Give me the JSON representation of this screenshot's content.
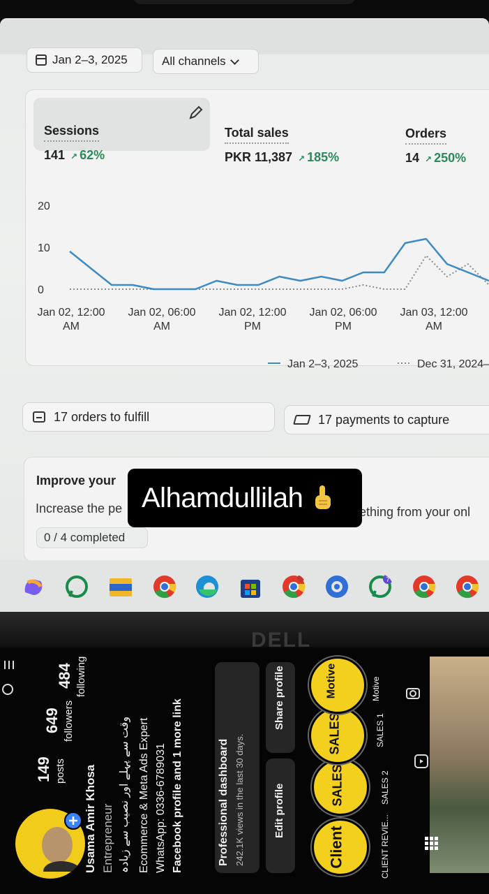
{
  "caption": "Alhamdullilah",
  "dashboard": {
    "date_filter": "Jan 2–3, 2025",
    "channel_filter": "All channels",
    "metrics": [
      {
        "title": "Sessions",
        "value": "141",
        "change": "62%"
      },
      {
        "title": "Total sales",
        "value": "PKR 11,387",
        "change": "185%"
      },
      {
        "title": "Orders",
        "value": "14",
        "change": "250%"
      }
    ],
    "chart_data": {
      "type": "line",
      "y_ticks": [
        "20",
        "10",
        "0"
      ],
      "ylim": [
        0,
        20
      ],
      "x_ticks": [
        {
          "top": "Jan 02, 12:00",
          "bottom": "AM"
        },
        {
          "top": "Jan 02, 06:00",
          "bottom": "AM"
        },
        {
          "top": "Jan 02, 12:00",
          "bottom": "PM"
        },
        {
          "top": "Jan 02, 06:00",
          "bottom": "PM"
        },
        {
          "top": "Jan 03, 12:00",
          "bottom": "AM"
        }
      ],
      "series": [
        {
          "name": "Jan 2–3, 2025",
          "style": "solid",
          "color": "#3d8ac4",
          "values": [
            9,
            5,
            1,
            1,
            0,
            0,
            0,
            2,
            1,
            1,
            3,
            2,
            3,
            2,
            4,
            4,
            11,
            12,
            6,
            4,
            2
          ]
        },
        {
          "name": "Dec 31, 2024–",
          "style": "dotted",
          "color": "#8a8c8b",
          "values": [
            0,
            0,
            0,
            0,
            0,
            0,
            0,
            0,
            0,
            0,
            0,
            0,
            0,
            0,
            1,
            0,
            0,
            8,
            3,
            6,
            1
          ]
        }
      ]
    },
    "orders_to_fulfill": "17 orders to fulfill",
    "payments_to_capture": "17 payments to capture",
    "improve_title": "Improve your",
    "improve_text_left": "Increase the pe",
    "improve_text_right": "ething from your onl",
    "improve_progress": "0 / 4 completed"
  },
  "taskbar": {
    "icons": [
      "copilot-icon",
      "whatsapp-icon",
      "file-explorer-icon",
      "chrome-icon",
      "edge-icon",
      "store-icon",
      "chrome-icon",
      "chrome-remote-icon",
      "whatsapp-icon",
      "chrome-icon",
      "chrome-icon"
    ],
    "whatsapp_badge": "7"
  },
  "laptop_brand": "DELL",
  "instagram": {
    "name": "Usama Amir Khosa",
    "category": "Entrepreneur",
    "bio_urdu": "وقت سے پہلے اور نصیب سے زیادہ",
    "bio_line": "Ecommerce & Meta Ads Expert",
    "whatsapp": "WhatsApp: 0336-6789031",
    "links": "Facebook profile and 1 more link",
    "posts_count": "149",
    "posts_label": "posts",
    "followers_count": "649",
    "followers_label": "followers",
    "following_count": "484",
    "following_label": "following",
    "dashboard_title": "Professional dashboard",
    "dashboard_sub": "242.1K views in the last 30 days.",
    "edit_profile": "Edit profile",
    "share_profile": "Share profile",
    "highlights": [
      {
        "cover": "Client",
        "label": "CLIENT REVIE..."
      },
      {
        "cover": "SALES",
        "label": "SALES 2"
      },
      {
        "cover": "SALES",
        "label": "SALES 1"
      },
      {
        "cover": "Motive",
        "label": "Motive"
      }
    ]
  }
}
